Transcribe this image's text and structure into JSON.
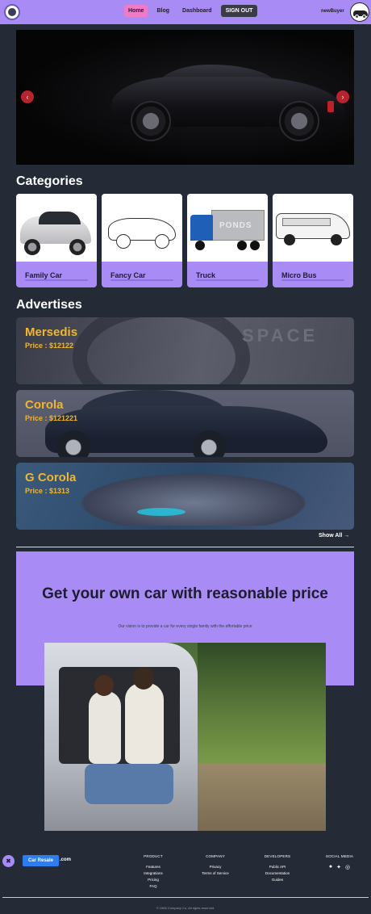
{
  "nav": {
    "links": [
      "Home",
      "Blog",
      "Dashboard"
    ],
    "signout_label": "SIGN OUT",
    "username": "newBuyer"
  },
  "carousel": {
    "prev_icon": "chevron-left-icon",
    "next_icon": "chevron-right-icon",
    "prev_glyph": "‹",
    "next_glyph": "›"
  },
  "categories": {
    "title": "Categories",
    "items": [
      {
        "label": "Family Car"
      },
      {
        "label": "Fancy Car"
      },
      {
        "label": "Truck"
      },
      {
        "label": "Micro Bus"
      }
    ],
    "truck_text": "PONDS"
  },
  "advertises": {
    "title": "Advertises",
    "items": [
      {
        "name": "Mersedis",
        "price": "Price : $12122"
      },
      {
        "name": "Corola",
        "price": "Price : $121221"
      },
      {
        "name": "G Corola",
        "price": "Price : $1313"
      }
    ],
    "ad1_text": "SPACE",
    "show_all": "Show All →"
  },
  "promo": {
    "heading": "Get your own car with reasonable price",
    "subtitle": "Our vision is to provide a car for every single family with the affortable price"
  },
  "footer": {
    "brand": "Car Resale",
    "brand_suffix": ".com",
    "columns": [
      {
        "heading": "PRODUCT",
        "items": [
          "Features",
          "Integrations",
          "Pricing",
          "FAQ"
        ]
      },
      {
        "heading": "COMPANY",
        "items": [
          "Privacy",
          "Terms of Service"
        ]
      },
      {
        "heading": "DEVELOPERS",
        "items": [
          "Public API",
          "Documentation",
          "Guides"
        ]
      }
    ],
    "social_heading": "SOCIAL MEDIA",
    "copyright": "© 1968 Company Co. All rights reserved."
  },
  "colors": {
    "accent": "#a98bf5",
    "background": "#252a37",
    "price": "#f0b62c",
    "active_link": "#f07ac8"
  }
}
